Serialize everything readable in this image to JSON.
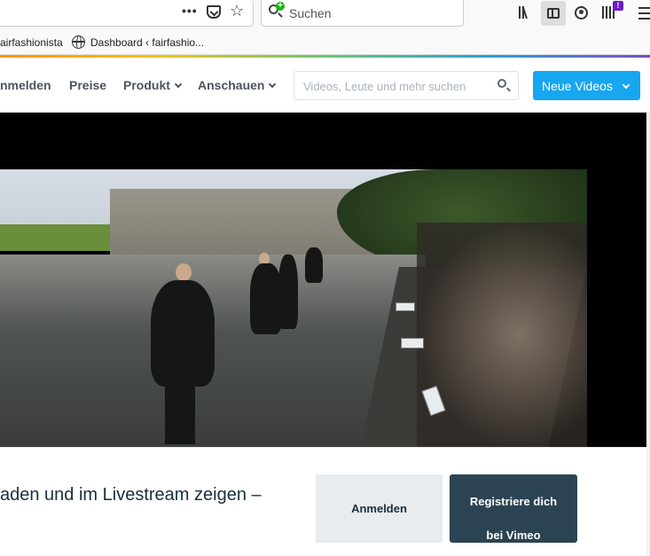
{
  "browser": {
    "toolbar": {
      "more_actions_label": "•••",
      "search_placeholder": "Suchen"
    },
    "bookmarks": [
      {
        "label": "airfashionista"
      },
      {
        "label": "Dashboard ‹ fairfashio..."
      }
    ],
    "extension_badge": "!"
  },
  "vimeo": {
    "nav": {
      "login": "nmelden",
      "pricing": "Preise",
      "product": "Produkt",
      "watch": "Anschauen"
    },
    "search": {
      "placeholder": "Videos, Leute und mehr suchen"
    },
    "new_videos_button": "Neue Videos",
    "signup": {
      "text": "aden und im Livestream zeigen –",
      "login_button": "Anmelden",
      "register_line1": "Registriere dich",
      "register_line2": "bei Vimeo"
    },
    "colors": {
      "accent": "#17a6f0",
      "dark_button": "#2c4353",
      "nav_text": "#4b5460"
    }
  }
}
